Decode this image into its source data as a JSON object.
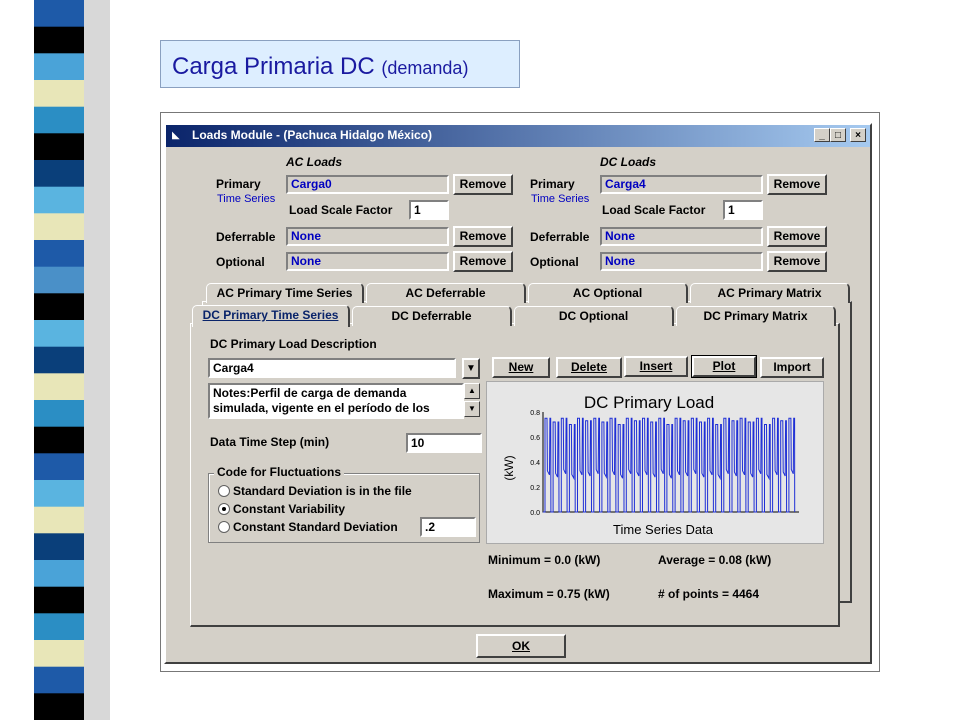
{
  "slide": {
    "title_main": "Carga Primaria DC",
    "title_sub": "(demanda)",
    "stripe_colors": [
      "#1e5aa8",
      "#000000",
      "#4aa3d8",
      "#e8e6b8",
      "#2b8ec4",
      "#000000",
      "#0a3f7a",
      "#5ab4e0",
      "#e8e6b8",
      "#1e5aa8",
      "#4a90c8",
      "#000000",
      "#5ab4e0",
      "#0a3f7a",
      "#e8e6b8",
      "#2b8ec4",
      "#000000",
      "#1e5aa8",
      "#5ab4e0",
      "#e8e6b8",
      "#0a3f7a",
      "#4aa3d8",
      "#000000",
      "#2b8ec4",
      "#e8e6b8",
      "#1e5aa8",
      "#000000"
    ]
  },
  "window": {
    "title": "Loads Module - (Pachuca Hidalgo México)",
    "minimize": "_",
    "maximize": "□",
    "close": "×"
  },
  "ac_loads": {
    "header": "AC Loads",
    "primary_label": "Primary",
    "timeseries_label": "Time Series",
    "primary_value": "Carga0",
    "scale_label": "Load Scale Factor",
    "scale_value": "1",
    "deferrable_label": "Deferrable",
    "deferrable_value": "None",
    "optional_label": "Optional",
    "optional_value": "None",
    "remove": "Remove"
  },
  "dc_loads": {
    "header": "DC Loads",
    "primary_label": "Primary",
    "timeseries_label": "Time Series",
    "primary_value": "Carga4",
    "scale_label": "Load Scale Factor",
    "scale_value": "1",
    "deferrable_label": "Deferrable",
    "deferrable_value": "None",
    "optional_label": "Optional",
    "optional_value": "None",
    "remove": "Remove"
  },
  "tabs_back": [
    "AC Primary Time Series",
    "AC Deferrable",
    "AC Optional",
    "AC Primary Matrix"
  ],
  "tabs_front": [
    "DC Primary Time Series",
    "DC Deferrable",
    "DC Optional",
    "DC Primary Matrix"
  ],
  "panel": {
    "desc_label": "DC Primary Load Description",
    "desc_value": "Carga4",
    "buttons": {
      "new": "New",
      "delete": "Delete",
      "insert": "Insert",
      "plot": "Plot",
      "import": "Import"
    },
    "notes_line1": "Notes:Perfil de carga de demanda",
    "notes_line2": "simulada, vigente en el período de los",
    "timestep_label": "Data Time Step (min)",
    "timestep_value": "10",
    "fluct_label": "Code for Fluctuations",
    "radio_std": "Standard Deviation is in the file",
    "radio_const_var": "Constant Variability",
    "radio_const_std": "Constant Standard Deviation",
    "const_std_value": ".2",
    "minimum": "Minimum = 0.0 (kW)",
    "average": "Average = 0.08 (kW)",
    "maximum": "Maximum = 0.75 (kW)",
    "points": "# of points = 4464"
  },
  "ok_label": "OK",
  "chart_data": {
    "type": "line",
    "title": "DC Primary Load",
    "xlabel": "Time Series Data",
    "ylabel": "(kW)",
    "ylim": [
      0,
      0.8
    ],
    "yticks": [
      "0.0",
      "0.2",
      "0.4",
      "0.6",
      "0.8"
    ],
    "grid": false,
    "series_color": "#1f2fd6",
    "pulses": 31,
    "peak_values": [
      0.75,
      0.72,
      0.75,
      0.7,
      0.75,
      0.73,
      0.75,
      0.72,
      0.75,
      0.7,
      0.75,
      0.73,
      0.75,
      0.72,
      0.75,
      0.7,
      0.75,
      0.73,
      0.75,
      0.72,
      0.75,
      0.7,
      0.75,
      0.73,
      0.75,
      0.72,
      0.75,
      0.7,
      0.75,
      0.73,
      0.75
    ],
    "low_values": [
      0.33,
      0.31,
      0.34,
      0.3,
      0.33,
      0.32,
      0.34,
      0.31,
      0.33,
      0.3,
      0.34,
      0.32,
      0.33,
      0.31,
      0.34,
      0.3,
      0.33,
      0.32,
      0.34,
      0.31,
      0.33,
      0.3,
      0.34,
      0.32,
      0.33,
      0.31,
      0.34,
      0.3,
      0.33,
      0.32,
      0.34
    ]
  }
}
